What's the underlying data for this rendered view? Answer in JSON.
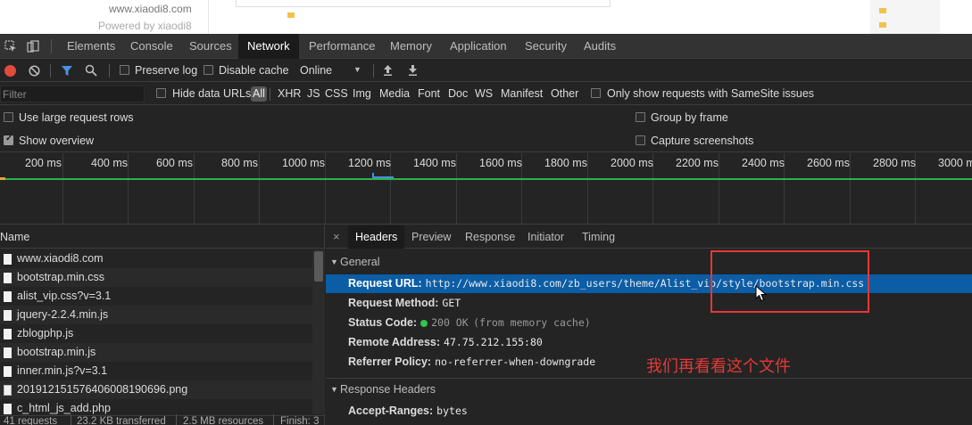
{
  "page_strip": {
    "site_url": "www.xiaodi8.com",
    "powered": "Powered by xiaodi8"
  },
  "main_tabs": [
    "Elements",
    "Console",
    "Sources",
    "Network",
    "Performance",
    "Memory",
    "Application",
    "Security",
    "Audits"
  ],
  "active_tab": "Network",
  "net_toolbar": {
    "preserve_log": "Preserve log",
    "disable_cache": "Disable cache",
    "throttle": "Online",
    "throttle_arrow": "▼"
  },
  "filter": {
    "placeholder": "Filter",
    "hide_data_urls": "Hide data URLs",
    "types": [
      "All",
      "XHR",
      "JS",
      "CSS",
      "Img",
      "Media",
      "Font",
      "Doc",
      "WS",
      "Manifest",
      "Other"
    ],
    "samesite": "Only show requests with SameSite issues"
  },
  "settings": {
    "large_rows": "Use large request rows",
    "show_overview": "Show overview",
    "group_by_frame": "Group by frame",
    "capture_screenshots": "Capture screenshots"
  },
  "timeline_ticks": [
    "200 ms",
    "400 ms",
    "600 ms",
    "800 ms",
    "1000 ms",
    "1200 ms",
    "1400 ms",
    "1600 ms",
    "1800 ms",
    "2000 ms",
    "2200 ms",
    "2400 ms",
    "2600 ms",
    "2800 ms",
    "3000 m"
  ],
  "requests": {
    "header": "Name",
    "files": [
      "www.xiaodi8.com",
      "bootstrap.min.css",
      "alist_vip.css?v=3.1",
      "jquery-2.2.4.min.js",
      "zblogphp.js",
      "bootstrap.min.js",
      "inner.min.js?v=3.1",
      "20191215157640600819069​6.png",
      "c_html_js_add.php"
    ],
    "status": [
      "41 requests",
      "23.2 KB transferred",
      "2.5 MB resources",
      "Finish: 3"
    ]
  },
  "detail": {
    "close": "×",
    "tabs": [
      "Headers",
      "Preview",
      "Response",
      "Initiator",
      "Timing"
    ],
    "active_tab": "Headers",
    "general_title": "General",
    "general": [
      {
        "key": "Request URL:",
        "value": "http://www.xiaodi8.com/zb_users/theme/Alist_vip/style/bootstrap.min.css"
      },
      {
        "key": "Request Method:",
        "value": "GET"
      },
      {
        "key": "Status Code:",
        "value": "200 OK",
        "extra": "(from memory cache)"
      },
      {
        "key": "Remote Address:",
        "value": "47.75.212.155:80"
      },
      {
        "key": "Referrer Policy:",
        "value": "no-referrer-when-downgrade"
      }
    ],
    "response_headers_title": "Response Headers",
    "response_headers": [
      {
        "key": "Accept-Ranges:",
        "value": "bytes"
      }
    ]
  },
  "caption": "我们再看看这个文件",
  "colors": {
    "selected_row": "#0b5da6",
    "annotation_red": "#e53935",
    "status_green": "#33c24a"
  }
}
